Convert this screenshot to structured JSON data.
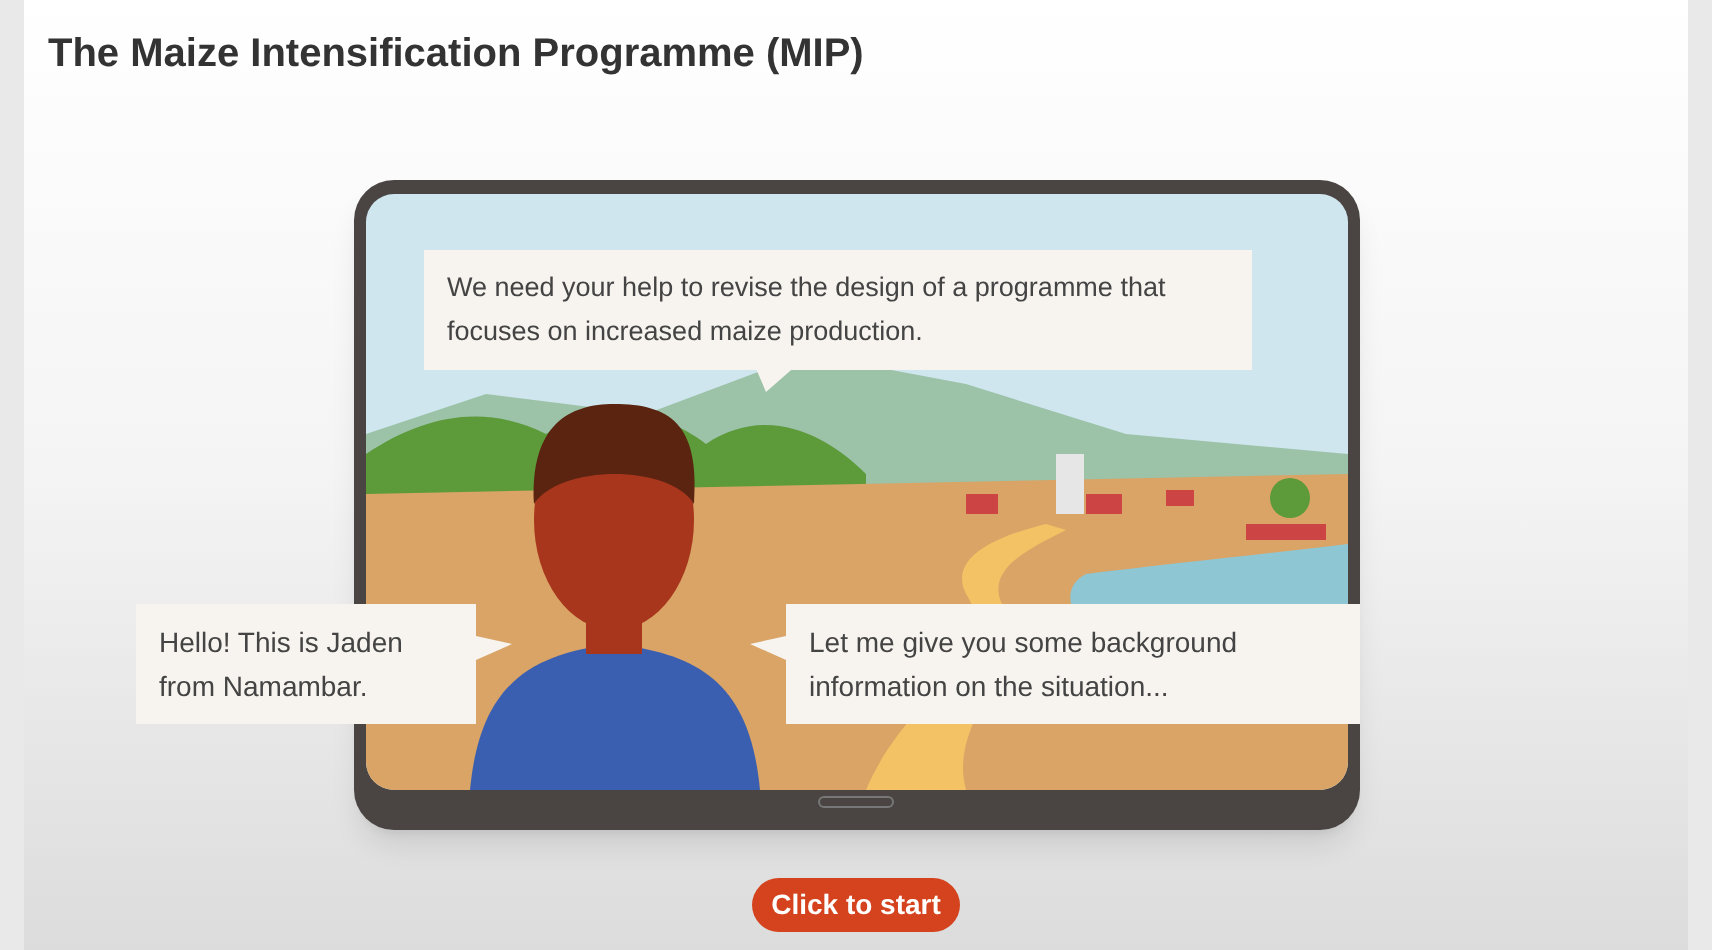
{
  "title": "The Maize Intensification Programme (MIP)",
  "speech_bubbles": [
    {
      "text": "We need your help to revise the design of a programme that focuses on increased maize production."
    },
    {
      "text": "Hello! This is Jaden from Namambar."
    },
    {
      "text": "Let me give you some background information on the situation..."
    }
  ],
  "start_button": {
    "label": "Click to start"
  }
}
